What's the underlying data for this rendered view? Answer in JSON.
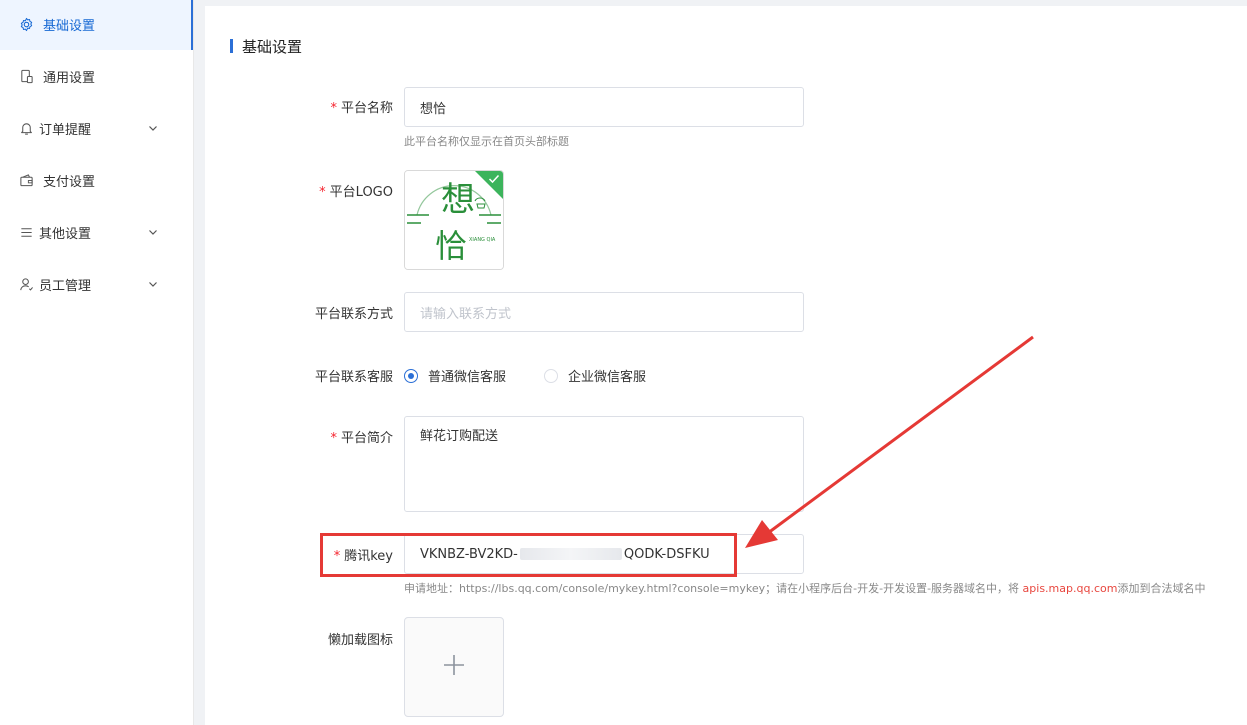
{
  "sidebar": {
    "items": [
      {
        "label": "基础设置",
        "icon": "gear-icon",
        "active": true
      },
      {
        "label": "通用设置",
        "icon": "device-icon"
      },
      {
        "label": "订单提醒",
        "icon": "bell-icon",
        "expandable": true
      },
      {
        "label": "支付设置",
        "icon": "wallet-icon"
      },
      {
        "label": "其他设置",
        "icon": "list-icon",
        "expandable": true
      },
      {
        "label": "员工管理",
        "icon": "user-icon",
        "expandable": true
      }
    ]
  },
  "main": {
    "section_title": "基础设置",
    "platform_name": {
      "label": "平台名称",
      "value": "想恰",
      "hint": "此平台名称仅显示在首页头部标题"
    },
    "platform_logo": {
      "label": "平台LOGO",
      "logo_text_top": "想",
      "logo_text_bottom": "恰",
      "logo_sub": "XIANG QIA"
    },
    "contact": {
      "label": "平台联系方式",
      "placeholder": "请输入联系方式"
    },
    "customer_service": {
      "label": "平台联系客服",
      "options": [
        "普通微信客服",
        "企业微信客服"
      ],
      "selected": "普通微信客服"
    },
    "intro": {
      "label": "平台简介",
      "value": "鲜花订购配送"
    },
    "tencent_key": {
      "label": "腾讯key",
      "value_start": "VKNBZ-BV2KD-",
      "value_end": "QODK-DSFKU",
      "hint_prefix": "申请地址：https://lbs.qq.com/console/mykey.html?console=mykey；请在小程序后台-开发-开发设置-服务器域名中，将 ",
      "hint_link": "apis.map.qq.com",
      "hint_suffix": "添加到合法域名中"
    },
    "lazy_icon": {
      "label": "懒加载图标"
    }
  },
  "colors": {
    "accent": "#2b6fd6",
    "required": "#f5222d",
    "annotation": "#e53935"
  }
}
